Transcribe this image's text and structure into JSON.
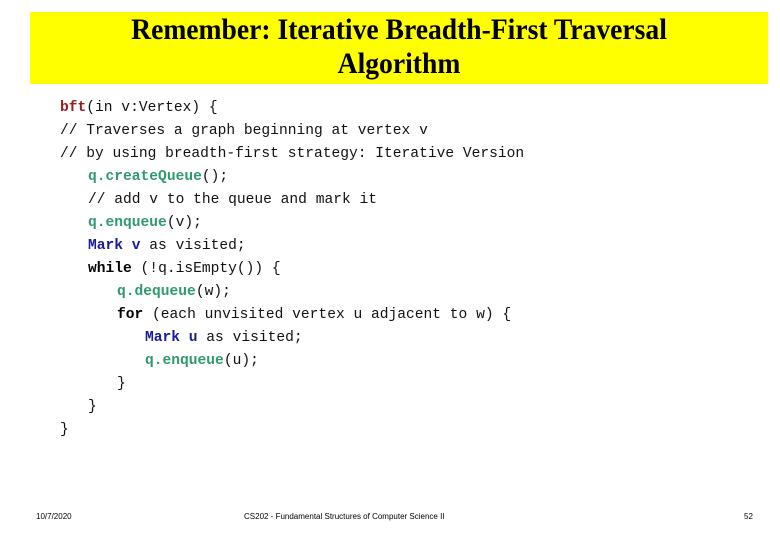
{
  "slide": {
    "title_line1": "Remember: Iterative Breadth-First Traversal",
    "title_line2": "Algorithm",
    "colors": {
      "title_band": "#ffff00",
      "function_name": "#9b1b1b",
      "mark_keyword": "#1a1a99",
      "queue_ops": "#2e9a6e"
    },
    "code": [
      {
        "indent": 0,
        "parts": [
          {
            "t": "bft",
            "s": "red"
          },
          {
            "t": "(in v:Vertex) {",
            "s": ""
          }
        ]
      },
      {
        "indent": 0,
        "parts": [
          {
            "t": "// Traverses a graph beginning at vertex v",
            "s": ""
          }
        ]
      },
      {
        "indent": 0,
        "parts": [
          {
            "t": "// by using breadth-first strategy: Iterative Version",
            "s": ""
          }
        ]
      },
      {
        "indent": 1,
        "parts": [
          {
            "t": "q.createQueue",
            "s": "green"
          },
          {
            "t": "();",
            "s": ""
          }
        ]
      },
      {
        "indent": 1,
        "parts": [
          {
            "t": "// add v to the queue and mark it",
            "s": ""
          }
        ]
      },
      {
        "indent": 1,
        "parts": [
          {
            "t": "q.enqueue",
            "s": "green"
          },
          {
            "t": "(v);",
            "s": ""
          }
        ]
      },
      {
        "indent": 1,
        "parts": [
          {
            "t": "Mark v",
            "s": "blue"
          },
          {
            "t": " as visited;",
            "s": ""
          }
        ]
      },
      {
        "indent": 1,
        "parts": [
          {
            "t": "while",
            "s": "black"
          },
          {
            "t": " (!q.isEmpty()) {",
            "s": ""
          }
        ]
      },
      {
        "indent": 2,
        "parts": [
          {
            "t": "q.dequeue",
            "s": "green"
          },
          {
            "t": "(w);",
            "s": ""
          }
        ]
      },
      {
        "indent": 2,
        "parts": [
          {
            "t": "for",
            "s": "black"
          },
          {
            "t": " (each unvisited vertex u adjacent to w) {",
            "s": ""
          }
        ]
      },
      {
        "indent": 3,
        "parts": [
          {
            "t": "Mark u",
            "s": "blue"
          },
          {
            "t": " as visited;",
            "s": ""
          }
        ]
      },
      {
        "indent": 3,
        "parts": [
          {
            "t": "q.enqueue",
            "s": "green"
          },
          {
            "t": "(u);",
            "s": ""
          }
        ]
      },
      {
        "indent": 2,
        "parts": [
          {
            "t": "}",
            "s": ""
          }
        ]
      },
      {
        "indent": 1,
        "parts": [
          {
            "t": "}",
            "s": ""
          }
        ]
      },
      {
        "indent": 0,
        "parts": [
          {
            "t": "}",
            "s": ""
          }
        ]
      }
    ]
  },
  "footer": {
    "date": "10/7/2020",
    "course": "CS202 - Fundamental Structures of Computer Science II",
    "page": "52"
  }
}
